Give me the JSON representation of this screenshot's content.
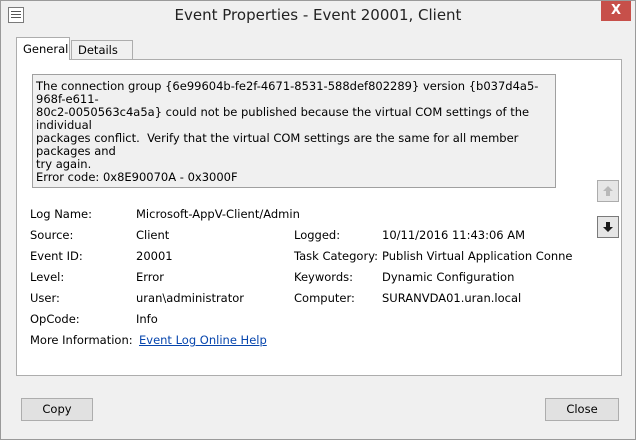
{
  "window": {
    "title": "Event Properties - Event 20001, Client",
    "close_label": "X"
  },
  "tabs": [
    {
      "label": "General",
      "active": true
    },
    {
      "label": "Details",
      "active": false
    }
  ],
  "description": "The connection group {6e99604b-fe2f-4671-8531-588def802289} version {b037d4a5-968f-e611-\n80c2-0050563c4a5a} could not be published because the virtual COM settings of the individual\npackages conflict.  Verify that the virtual COM settings are the same for all member packages and\ntry again.\nError code: 0x8E90070A - 0x3000F",
  "fields": {
    "log_name_label": "Log Name:",
    "log_name_value": "Microsoft-AppV-Client/Admin",
    "source_label": "Source:",
    "source_value": "Client",
    "logged_label": "Logged:",
    "logged_value": "10/11/2016 11:43:06 AM",
    "event_id_label": "Event ID:",
    "event_id_value": "20001",
    "task_category_label": "Task Category:",
    "task_category_value": "Publish Virtual Application Conne",
    "level_label": "Level:",
    "level_value": "Error",
    "keywords_label": "Keywords:",
    "keywords_value": "Dynamic Configuration",
    "user_label": "User:",
    "user_value": "uran\\administrator",
    "computer_label": "Computer:",
    "computer_value": "SURANVDA01.uran.local",
    "opcode_label": "OpCode:",
    "opcode_value": "Info",
    "more_info_label": "More Information:",
    "more_info_link": "Event Log Online Help"
  },
  "buttons": {
    "copy": "Copy",
    "close": "Close"
  },
  "icons": {
    "window_icon": "event-log-icon",
    "up": "arrow-up-icon",
    "down": "arrow-down-icon"
  }
}
